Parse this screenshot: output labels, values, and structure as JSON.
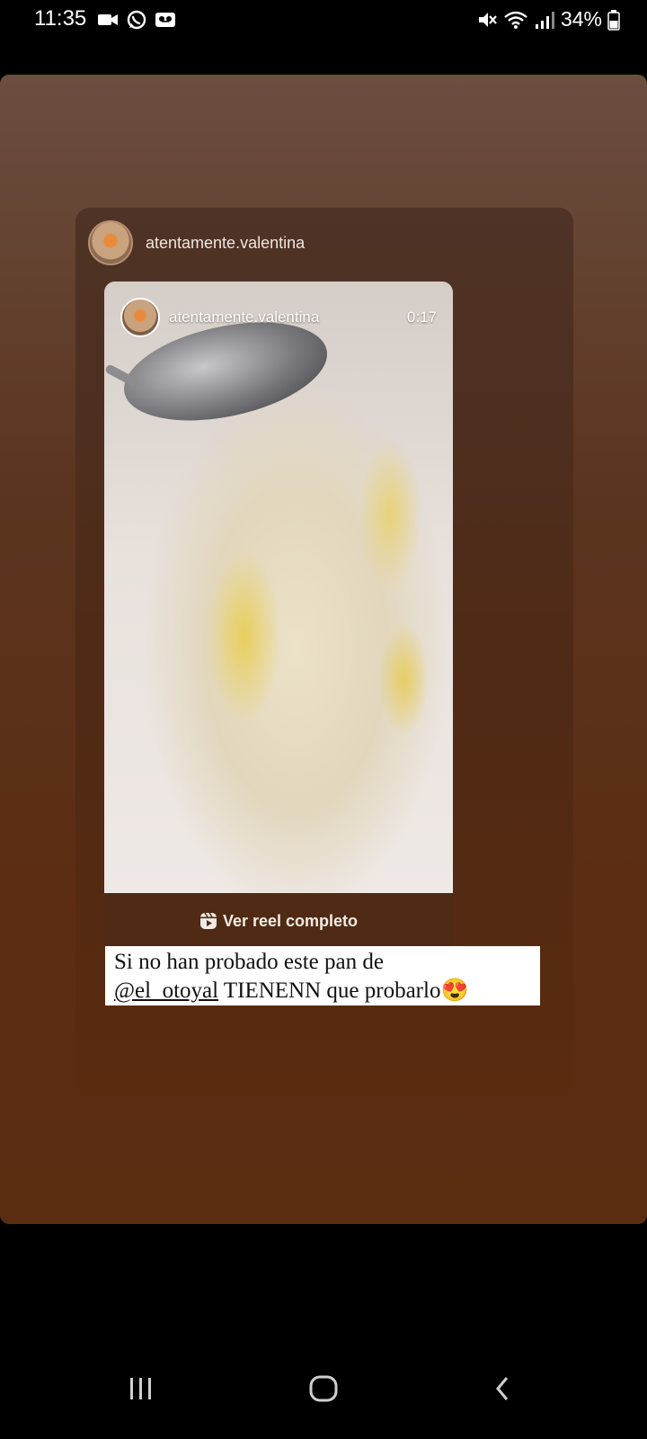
{
  "status_bar": {
    "time": "11:35",
    "battery": "34%",
    "left_icons": [
      "video-camera-icon",
      "whatsapp-icon",
      "voicemail-icon"
    ],
    "right_icons": [
      "mute-icon",
      "wifi-icon",
      "signal-icon",
      "battery-icon"
    ]
  },
  "post": {
    "username": "atentamente.valentina",
    "media": {
      "username": "atentamente.valentina",
      "duration": "0:17"
    },
    "reel_link_label": "Ver reel completo",
    "caption": {
      "line1": "Si no han probado este pan de",
      "mention": "@el_otoyal",
      "line2_rest": " TIENENN que probarlo😍"
    }
  },
  "nav_bar": {
    "buttons": [
      "recent-apps",
      "home",
      "back"
    ]
  },
  "colors": {
    "story_top": "#6b4e3f",
    "story_bottom": "#5a2c10",
    "reel_bar": "#4f2a14"
  }
}
